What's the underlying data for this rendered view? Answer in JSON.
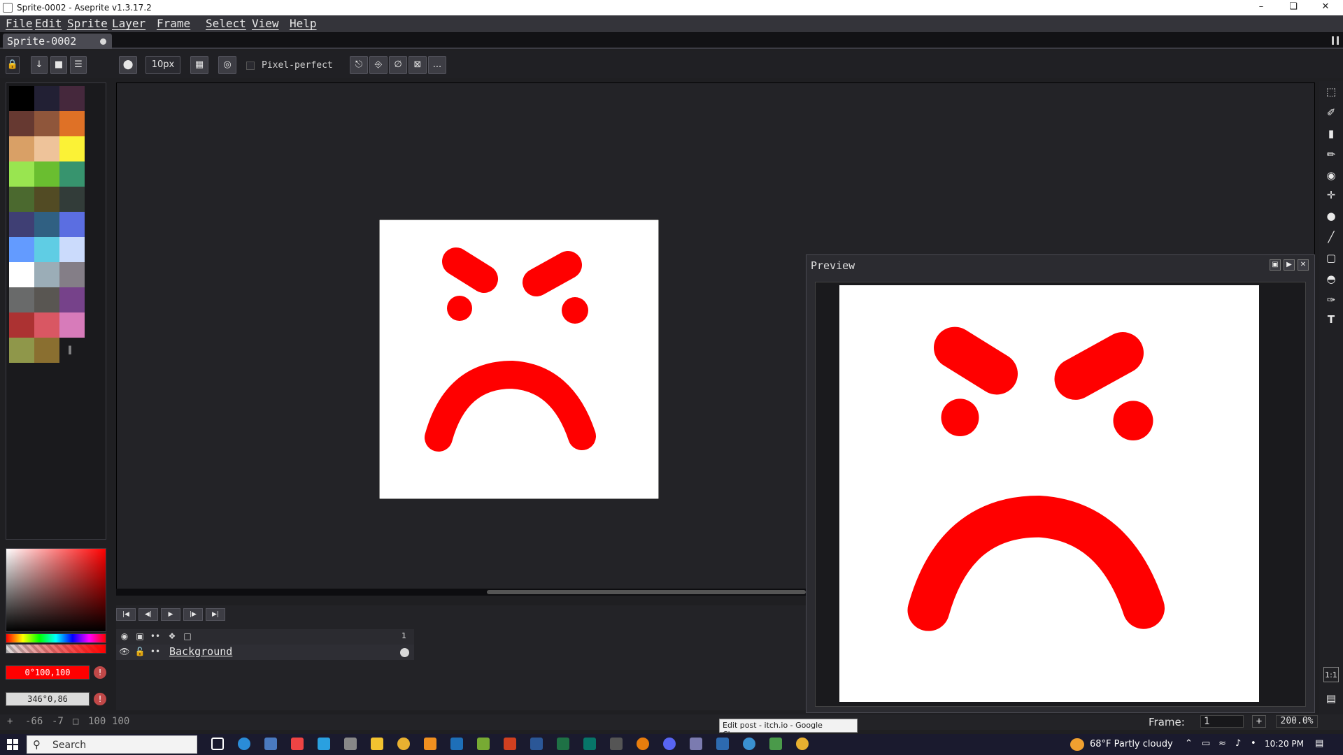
{
  "window": {
    "title": "Sprite-0002 - Aseprite v1.3.17.2"
  },
  "menu": [
    "File",
    "Edit",
    "Sprite",
    "Layer",
    "Frame",
    "Select",
    "View",
    "Help"
  ],
  "tab": {
    "label": "Sprite-0002"
  },
  "toolbar": {
    "brush_size": "10px",
    "pixel_perfect": "Pixel-perfect",
    "more": "..."
  },
  "palette": [
    "#000000",
    "#222034",
    "#45283c",
    "#663931",
    "#8f563b",
    "#df7126",
    "#d9a066",
    "#eec39a",
    "#fbf236",
    "#99e550",
    "#6abe30",
    "#37946e",
    "#4b692f",
    "#524b24",
    "#323c39",
    "#3f3f74",
    "#306082",
    "#5b6ee1",
    "#639bff",
    "#5fcde4",
    "#cbdbfc",
    "#ffffff",
    "#9badb7",
    "#847e87",
    "#696a6a",
    "#595652",
    "#76428a",
    "#ac3232",
    "#d95763",
    "#d77bba",
    "#8f974a",
    "#8a6f30"
  ],
  "colors": {
    "foreground": "0°100,100",
    "background": "346°0,86",
    "fg_hex": "#ff0000",
    "bg_hex": "#dbdbdb"
  },
  "timeline": {
    "frame_header": "1",
    "layers": [
      {
        "name": "Background"
      }
    ]
  },
  "preview": {
    "title": "Preview"
  },
  "status": {
    "coords_x": "-66",
    "coords_y": "-7",
    "size_w": "100",
    "size_h": "100",
    "frame_label": "Frame:",
    "frame_value": "1",
    "zoom": "200.0%"
  },
  "tooltip": "Edit post - itch.io - Google Chrome",
  "taskbar": {
    "search_label": "Search",
    "weather": "68°F  Partly cloudy",
    "time": "10:20 PM"
  }
}
